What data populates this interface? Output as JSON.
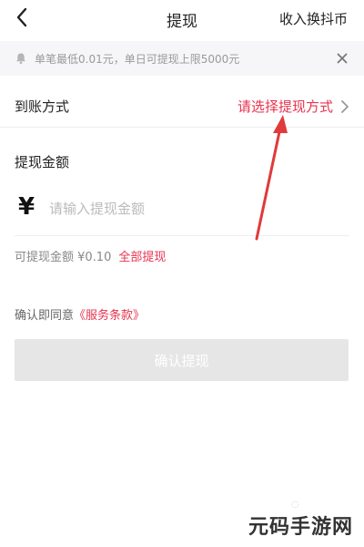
{
  "header": {
    "title": "提现",
    "right_action": "收入换抖币"
  },
  "notice": {
    "text": "单笔最低0.01元，单日可提现上限5000元"
  },
  "method_row": {
    "label": "到账方式",
    "action_text": "请选择提现方式"
  },
  "amount": {
    "title": "提现金额",
    "currency_symbol": "¥",
    "placeholder": "请输入提现金额",
    "value": ""
  },
  "available": {
    "text": "可提现金额 ¥0.10",
    "withdraw_all": "全部提现"
  },
  "agreement": {
    "prefix": "确认即同意",
    "terms_link": "《服务条款》"
  },
  "confirm_button": {
    "label": "确认提现"
  },
  "watermark": {
    "text": "元码手游网"
  },
  "colors": {
    "accent": "#e8334f",
    "annotation_arrow": "#e03a3a",
    "button_disabled": "#e6e6e6",
    "notice_bg": "#f6f6f8"
  }
}
